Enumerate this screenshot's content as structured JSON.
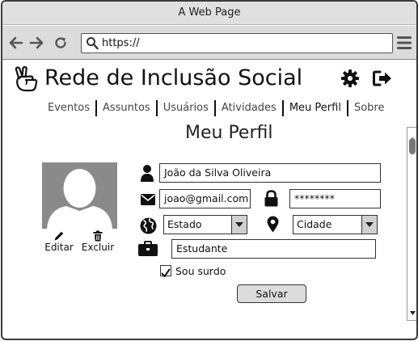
{
  "browser": {
    "window_title": "A Web Page",
    "url": "https://"
  },
  "site": {
    "title": "Rede de Inclusão Social"
  },
  "nav": {
    "items": [
      "Eventos",
      "Assuntos",
      "Usuários",
      "Atividades",
      "Meu Perfil",
      "Sobre"
    ],
    "active": "Meu Perfil"
  },
  "profile": {
    "page_title": "Meu Perfil",
    "edit_label": "Editar",
    "delete_label": "Excluir",
    "name": "João da Silva Oliveira",
    "email": "joao@gmail.com",
    "password": "********",
    "state": "Estado",
    "city": "Cidade",
    "occupation": "Estudante",
    "deaf_label": "Sou surdo",
    "deaf_checked": true,
    "save_label": "Salvar"
  }
}
